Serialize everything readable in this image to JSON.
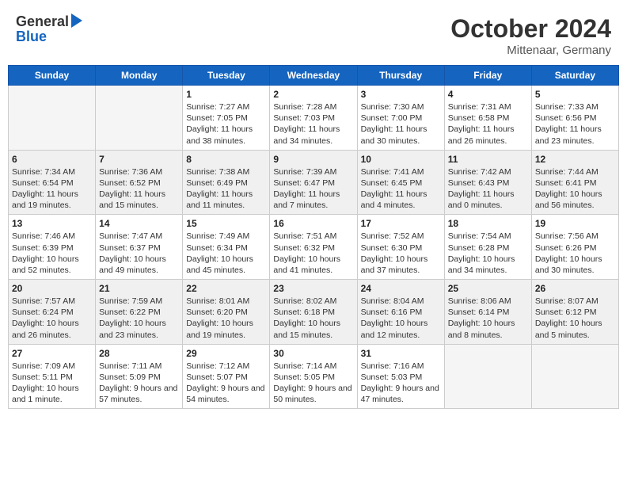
{
  "header": {
    "logo_line1": "General",
    "logo_line2": "Blue",
    "month_year": "October 2024",
    "location": "Mittenaar, Germany"
  },
  "weekdays": [
    "Sunday",
    "Monday",
    "Tuesday",
    "Wednesday",
    "Thursday",
    "Friday",
    "Saturday"
  ],
  "weeks": [
    [
      {
        "day": "",
        "empty": true
      },
      {
        "day": "",
        "empty": true
      },
      {
        "day": "1",
        "sunrise": "7:27 AM",
        "sunset": "7:05 PM",
        "daylight": "11 hours and 38 minutes."
      },
      {
        "day": "2",
        "sunrise": "7:28 AM",
        "sunset": "7:03 PM",
        "daylight": "11 hours and 34 minutes."
      },
      {
        "day": "3",
        "sunrise": "7:30 AM",
        "sunset": "7:00 PM",
        "daylight": "11 hours and 30 minutes."
      },
      {
        "day": "4",
        "sunrise": "7:31 AM",
        "sunset": "6:58 PM",
        "daylight": "11 hours and 26 minutes."
      },
      {
        "day": "5",
        "sunrise": "7:33 AM",
        "sunset": "6:56 PM",
        "daylight": "11 hours and 23 minutes."
      }
    ],
    [
      {
        "day": "6",
        "sunrise": "7:34 AM",
        "sunset": "6:54 PM",
        "daylight": "11 hours and 19 minutes."
      },
      {
        "day": "7",
        "sunrise": "7:36 AM",
        "sunset": "6:52 PM",
        "daylight": "11 hours and 15 minutes."
      },
      {
        "day": "8",
        "sunrise": "7:38 AM",
        "sunset": "6:49 PM",
        "daylight": "11 hours and 11 minutes."
      },
      {
        "day": "9",
        "sunrise": "7:39 AM",
        "sunset": "6:47 PM",
        "daylight": "11 hours and 7 minutes."
      },
      {
        "day": "10",
        "sunrise": "7:41 AM",
        "sunset": "6:45 PM",
        "daylight": "11 hours and 4 minutes."
      },
      {
        "day": "11",
        "sunrise": "7:42 AM",
        "sunset": "6:43 PM",
        "daylight": "11 hours and 0 minutes."
      },
      {
        "day": "12",
        "sunrise": "7:44 AM",
        "sunset": "6:41 PM",
        "daylight": "10 hours and 56 minutes."
      }
    ],
    [
      {
        "day": "13",
        "sunrise": "7:46 AM",
        "sunset": "6:39 PM",
        "daylight": "10 hours and 52 minutes."
      },
      {
        "day": "14",
        "sunrise": "7:47 AM",
        "sunset": "6:37 PM",
        "daylight": "10 hours and 49 minutes."
      },
      {
        "day": "15",
        "sunrise": "7:49 AM",
        "sunset": "6:34 PM",
        "daylight": "10 hours and 45 minutes."
      },
      {
        "day": "16",
        "sunrise": "7:51 AM",
        "sunset": "6:32 PM",
        "daylight": "10 hours and 41 minutes."
      },
      {
        "day": "17",
        "sunrise": "7:52 AM",
        "sunset": "6:30 PM",
        "daylight": "10 hours and 37 minutes."
      },
      {
        "day": "18",
        "sunrise": "7:54 AM",
        "sunset": "6:28 PM",
        "daylight": "10 hours and 34 minutes."
      },
      {
        "day": "19",
        "sunrise": "7:56 AM",
        "sunset": "6:26 PM",
        "daylight": "10 hours and 30 minutes."
      }
    ],
    [
      {
        "day": "20",
        "sunrise": "7:57 AM",
        "sunset": "6:24 PM",
        "daylight": "10 hours and 26 minutes."
      },
      {
        "day": "21",
        "sunrise": "7:59 AM",
        "sunset": "6:22 PM",
        "daylight": "10 hours and 23 minutes."
      },
      {
        "day": "22",
        "sunrise": "8:01 AM",
        "sunset": "6:20 PM",
        "daylight": "10 hours and 19 minutes."
      },
      {
        "day": "23",
        "sunrise": "8:02 AM",
        "sunset": "6:18 PM",
        "daylight": "10 hours and 15 minutes."
      },
      {
        "day": "24",
        "sunrise": "8:04 AM",
        "sunset": "6:16 PM",
        "daylight": "10 hours and 12 minutes."
      },
      {
        "day": "25",
        "sunrise": "8:06 AM",
        "sunset": "6:14 PM",
        "daylight": "10 hours and 8 minutes."
      },
      {
        "day": "26",
        "sunrise": "8:07 AM",
        "sunset": "6:12 PM",
        "daylight": "10 hours and 5 minutes."
      }
    ],
    [
      {
        "day": "27",
        "sunrise": "7:09 AM",
        "sunset": "5:11 PM",
        "daylight": "10 hours and 1 minute."
      },
      {
        "day": "28",
        "sunrise": "7:11 AM",
        "sunset": "5:09 PM",
        "daylight": "9 hours and 57 minutes."
      },
      {
        "day": "29",
        "sunrise": "7:12 AM",
        "sunset": "5:07 PM",
        "daylight": "9 hours and 54 minutes."
      },
      {
        "day": "30",
        "sunrise": "7:14 AM",
        "sunset": "5:05 PM",
        "daylight": "9 hours and 50 minutes."
      },
      {
        "day": "31",
        "sunrise": "7:16 AM",
        "sunset": "5:03 PM",
        "daylight": "9 hours and 47 minutes."
      },
      {
        "day": "",
        "empty": true
      },
      {
        "day": "",
        "empty": true
      }
    ]
  ]
}
